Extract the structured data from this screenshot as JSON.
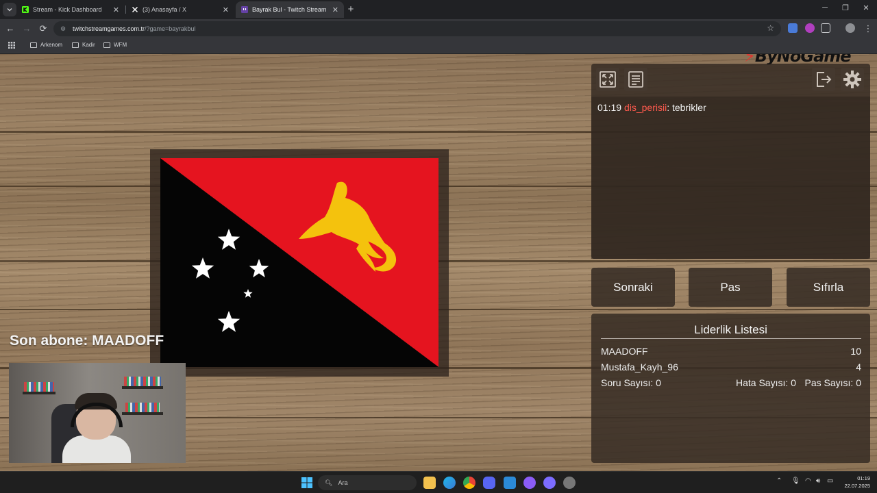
{
  "browser": {
    "tabs": [
      {
        "title": "Stream - Kick Dashboard",
        "active": false,
        "favicon_color": "#53fc18"
      },
      {
        "title": "(3) Anasayfa / X",
        "active": false,
        "favicon_color": "#ffffff"
      },
      {
        "title": "Bayrak Bul - Twitch Stream Gam",
        "active": true,
        "favicon_color": "#6441a5"
      }
    ],
    "url_host": "twitchstreamgames.com.tr",
    "url_rest": "/?game=bayrakbul",
    "bookmarks": [
      "Arkenom",
      "Kadir",
      "WFM"
    ]
  },
  "brand": {
    "name": "ByNoGame"
  },
  "flag": {
    "country": "Papua New Guinea",
    "colors": {
      "red": "#e5141f",
      "black": "#050505",
      "gold": "#f4c20d",
      "white": "#ffffff"
    }
  },
  "overlay": {
    "last_sub": "Son abone: MAADOFF"
  },
  "chat": {
    "messages": [
      {
        "time": "01:19",
        "user": "dis_perisii",
        "text": ": tebrikler"
      }
    ]
  },
  "toolbar_icons": {
    "left": [
      "fullscreen-icon",
      "notes-icon"
    ],
    "right": [
      "logout-icon",
      "settings-icon"
    ]
  },
  "controls": {
    "next": "Sonraki",
    "pass": "Pas",
    "reset": "Sıfırla"
  },
  "leaderboard": {
    "title": "Liderlik Listesi",
    "rows": [
      {
        "name": "MAADOFF",
        "score": "10"
      },
      {
        "name": "Mustafa_Kayh_96",
        "score": "4"
      }
    ],
    "stats": {
      "questions": "Soru Sayısı: 0",
      "errors": "Hata Sayısı: 0",
      "passes": "Pas Sayısı: 0"
    }
  },
  "taskbar": {
    "search_placeholder": "Ara",
    "time": "01:19",
    "date": "22.07.2025"
  }
}
